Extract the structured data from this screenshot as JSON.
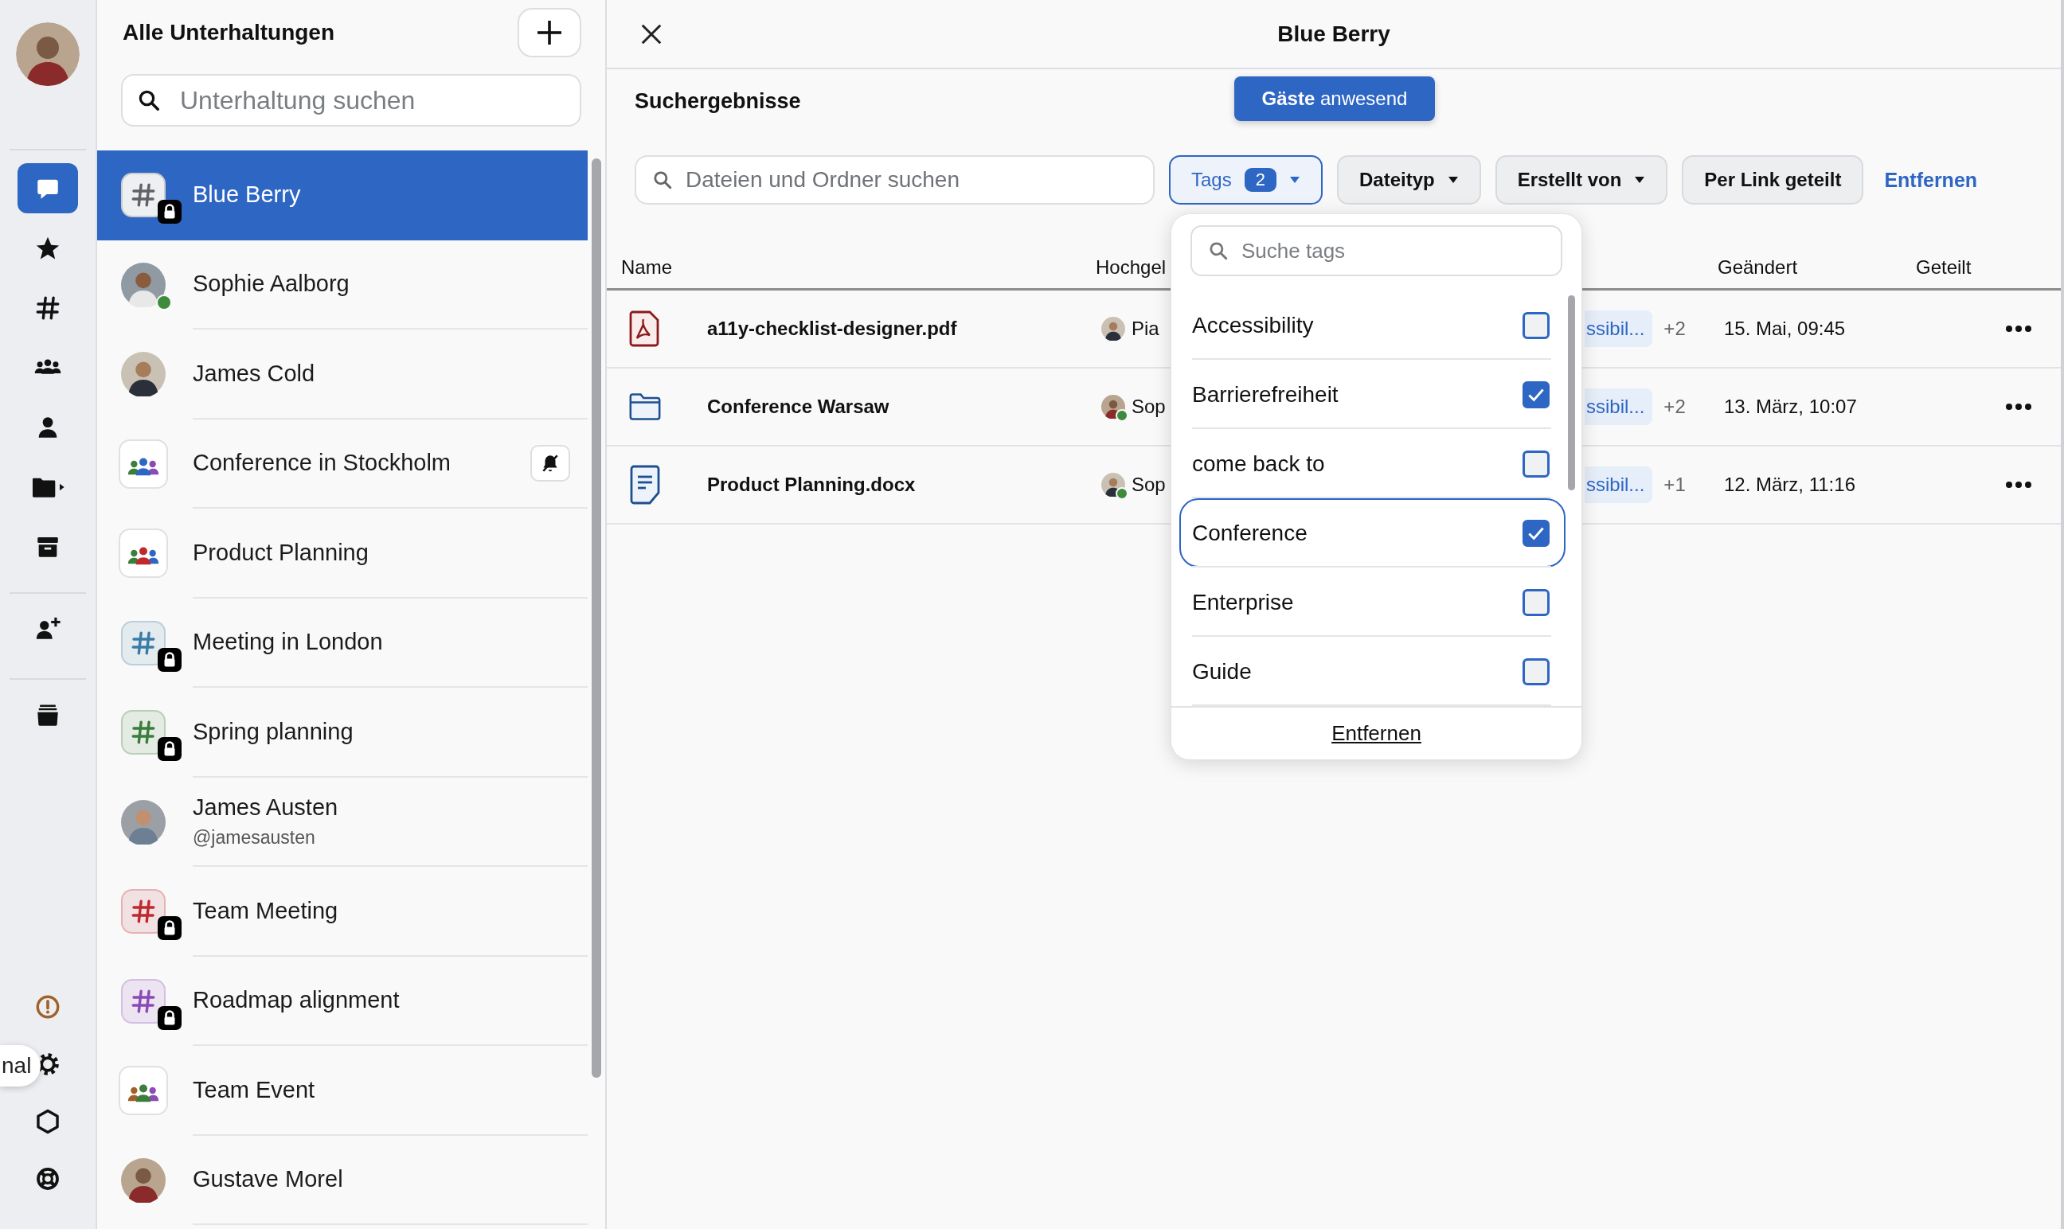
{
  "rail": {
    "items": [
      {
        "kind": "chat",
        "selected": true
      },
      {
        "kind": "starred",
        "selected": false
      },
      {
        "kind": "channels",
        "selected": false
      },
      {
        "kind": "groups",
        "selected": false
      },
      {
        "kind": "people",
        "selected": false
      },
      {
        "kind": "files",
        "selected": false
      },
      {
        "kind": "archive",
        "selected": false
      }
    ],
    "extra_items": [
      {
        "kind": "invite"
      },
      {
        "kind": "drawer"
      }
    ],
    "bottom_items": [
      {
        "kind": "alert"
      },
      {
        "kind": "settings"
      },
      {
        "kind": "apps"
      },
      {
        "kind": "help"
      }
    ],
    "tooltip": "nal"
  },
  "conversations": {
    "title": "Alle Unterhaltungen",
    "search": {
      "placeholder": "Unterhaltung suchen"
    },
    "items": [
      {
        "kind": "channel",
        "name": "Blue Berry",
        "color": "#5f6368",
        "locked": true,
        "muted": false,
        "selected": true
      },
      {
        "kind": "person",
        "name": "Sophie Aalborg",
        "online": true,
        "muted": false,
        "selected": false
      },
      {
        "kind": "person",
        "name": "James Cold",
        "online": false,
        "muted": false,
        "selected": false
      },
      {
        "kind": "group",
        "name": "Conference in Stockholm",
        "figures": [
          {
            "color": "#3b7d3b"
          },
          {
            "color": "#2e66c4"
          },
          {
            "color": "#8a4bb5"
          }
        ],
        "muted": true,
        "selected": false
      },
      {
        "kind": "group",
        "name": "Product Planning",
        "figures": [
          {
            "color": "#3b7d3b"
          },
          {
            "color": "#c0282d"
          },
          {
            "color": "#2e66c4"
          }
        ],
        "muted": false,
        "selected": false
      },
      {
        "kind": "channel",
        "name": "Meeting in London",
        "color": "#3a7ca5",
        "locked": true,
        "muted": false,
        "selected": false
      },
      {
        "kind": "channel",
        "name": "Spring planning",
        "color": "#3b7d3b",
        "locked": true,
        "muted": false,
        "selected": false
      },
      {
        "kind": "person",
        "name": "James Austen",
        "handle": "@jamesausten",
        "online": false,
        "muted": false,
        "selected": false
      },
      {
        "kind": "channel",
        "name": "Team Meeting",
        "color": "#c0282d",
        "locked": true,
        "muted": false,
        "selected": false
      },
      {
        "kind": "channel",
        "name": "Roadmap alignment",
        "color": "#8a4bb5",
        "locked": true,
        "muted": false,
        "selected": false
      },
      {
        "kind": "group",
        "name": "Team Event",
        "figures": [
          {
            "color": "#a0612a"
          },
          {
            "color": "#3b7d3b"
          },
          {
            "color": "#8a4bb5"
          }
        ],
        "muted": false,
        "selected": false
      },
      {
        "kind": "person",
        "name": "Gustave Morel",
        "online": false,
        "muted": false,
        "selected": false
      }
    ]
  },
  "main": {
    "title": "Blue Berry",
    "section_title": "Suchergebnisse",
    "notice": "**Gäste** anwesend",
    "search": {
      "placeholder": "Dateien und Ordner suchen"
    },
    "filters": [
      {
        "kind": "dropdown",
        "label": "Tags",
        "count": "2",
        "active": true
      },
      {
        "kind": "dropdown",
        "label": "Dateityp",
        "active": false
      },
      {
        "kind": "dropdown",
        "label": "Erstellt von",
        "active": false
      },
      {
        "kind": "toggle",
        "label": "Per Link geteilt",
        "active": false
      }
    ],
    "clear_filters": "Entfernen",
    "table": {
      "columns": [
        "Name",
        "Hochgel",
        "Geändert",
        "Geteilt"
      ],
      "rows": [
        {
          "kind": "pdf",
          "name": "a11y-checklist-designer.pdf",
          "uploader": "Pia",
          "uploader_online": false,
          "tag": "ssibil...",
          "tag_more": "+2",
          "changed": "15. Mai, 09:45"
        },
        {
          "kind": "folder",
          "name": "Conference Warsaw",
          "uploader": "Sop",
          "uploader_online": true,
          "tag": "ssibil...",
          "tag_more": "+2",
          "changed": "13. März, 10:07"
        },
        {
          "kind": "document",
          "name": "Product Planning.docx",
          "uploader": "Sop",
          "uploader_online": true,
          "tag": "ssibil...",
          "tag_more": "+1",
          "changed": "12. März, 11:16"
        }
      ]
    },
    "tag_menu": {
      "placeholder": "Suche tags",
      "options": [
        {
          "label": "Accessibility",
          "checked": false,
          "focused": false
        },
        {
          "label": "Barrierefreiheit",
          "checked": true,
          "focused": false
        },
        {
          "label": "come back to",
          "checked": false,
          "focused": false
        },
        {
          "label": "Conference",
          "checked": true,
          "focused": true
        },
        {
          "label": "Enterprise",
          "checked": false,
          "focused": false
        },
        {
          "label": "Guide",
          "checked": false,
          "focused": false
        }
      ],
      "clear": "Entfernen"
    }
  }
}
